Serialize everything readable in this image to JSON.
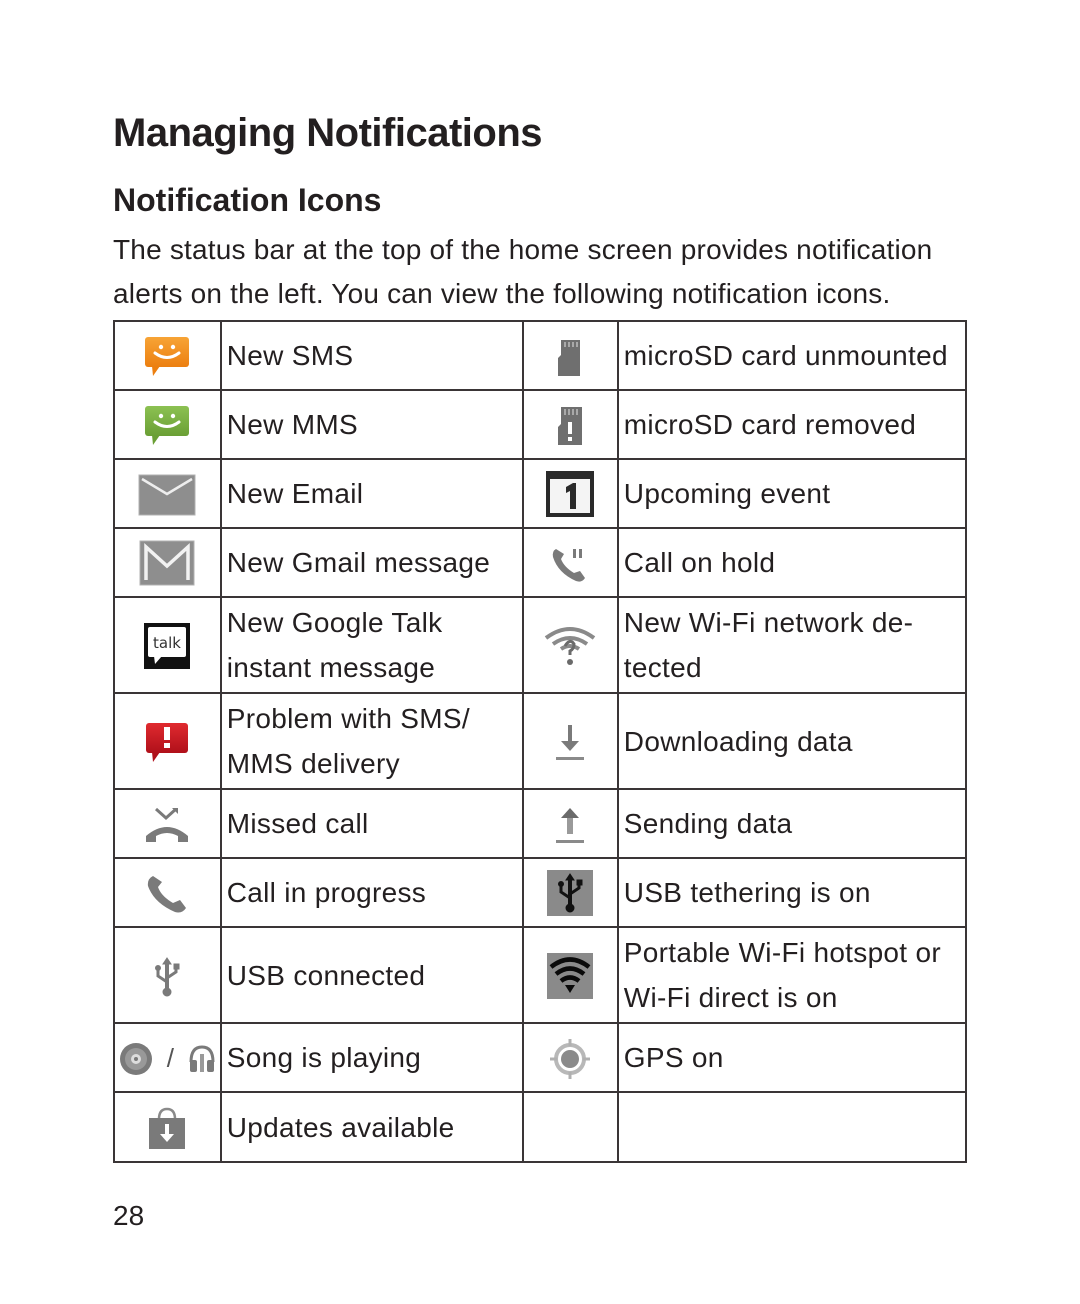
{
  "page": {
    "title": "Managing Notifications",
    "section_title": "Notification Icons",
    "intro": "The status bar at the top of the home screen provides notification alerts on the left. You can view the following notification icons.",
    "page_number": "28"
  },
  "table": {
    "rows": [
      {
        "left": {
          "icon": "sms-orange-smiley-bubble-icon",
          "label": "New SMS"
        },
        "right": {
          "icon": "microsd-card-icon",
          "label": "microSD card unmounted"
        }
      },
      {
        "left": {
          "icon": "mms-green-smiley-bubble-icon",
          "label": "New MMS"
        },
        "right": {
          "icon": "microsd-card-removed-icon",
          "label": "microSD card removed"
        }
      },
      {
        "left": {
          "icon": "envelope-icon",
          "label": "New Email"
        },
        "right": {
          "icon": "calendar-icon",
          "label": "Upcoming event"
        }
      },
      {
        "left": {
          "icon": "gmail-icon",
          "label": "New Gmail message"
        },
        "right": {
          "icon": "phone-hold-icon",
          "label": "Call on hold"
        }
      },
      {
        "left": {
          "icon": "talk-bubble-icon",
          "label": "New Google Talk instant message"
        },
        "right": {
          "icon": "wifi-question-icon",
          "label": "New Wi-Fi network de-tected"
        }
      },
      {
        "left": {
          "icon": "sms-error-icon",
          "label": "Problem with SMS/ MMS delivery"
        },
        "right": {
          "icon": "download-arrow-icon",
          "label": "Downloading data"
        }
      },
      {
        "left": {
          "icon": "missed-call-icon",
          "label": "Missed call"
        },
        "right": {
          "icon": "upload-arrow-icon",
          "label": "Sending data"
        }
      },
      {
        "left": {
          "icon": "phone-icon",
          "label": "Call in progress"
        },
        "right": {
          "icon": "usb-tethering-icon",
          "label": "USB tethering is on"
        }
      },
      {
        "left": {
          "icon": "usb-icon",
          "label": "USB connected"
        },
        "right": {
          "icon": "wifi-hotspot-icon",
          "label": "Portable Wi-Fi hotspot or Wi-Fi direct is on"
        }
      },
      {
        "left": {
          "icon": "disc-or-headphones-icon",
          "label": "Song is playing",
          "separator": "/"
        },
        "right": {
          "icon": "gps-icon",
          "label": "GPS on"
        }
      },
      {
        "left": {
          "icon": "shopping-bag-download-icon",
          "label": "Updates available"
        },
        "right": {
          "icon": "",
          "label": ""
        }
      }
    ]
  },
  "colors": {
    "sms_orange": "#f0901e",
    "mms_green": "#7cb342",
    "error_red": "#c8161d",
    "icon_gray": "#8a8a8a",
    "text": "#231f20",
    "border": "#3a3536"
  }
}
